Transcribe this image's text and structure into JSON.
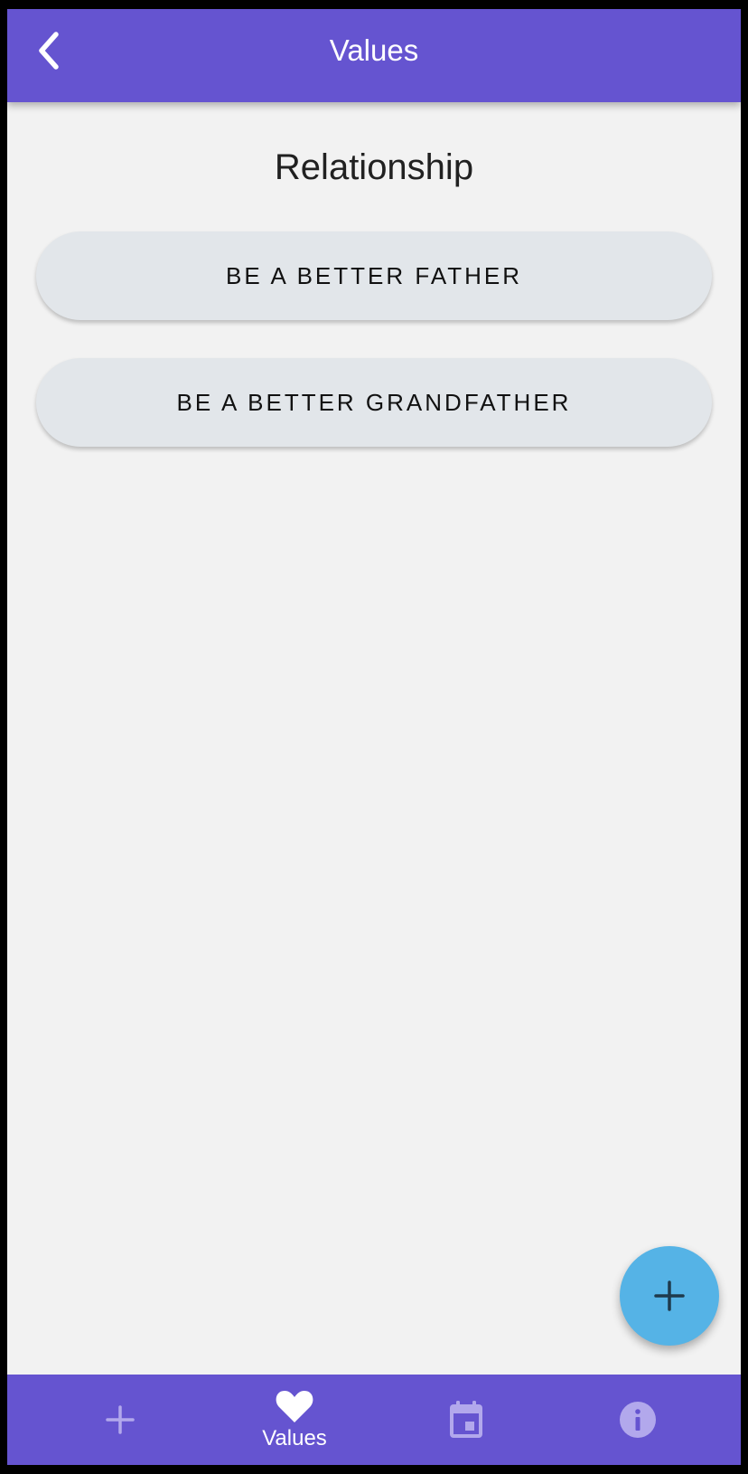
{
  "app_bar": {
    "title": "Values",
    "back_icon": "chevron-left-icon"
  },
  "section": {
    "title": "Relationship"
  },
  "values": [
    {
      "label": "BE A BETTER FATHER"
    },
    {
      "label": "BE A BETTER GRANDFATHER"
    }
  ],
  "fab": {
    "icon": "plus-icon"
  },
  "bottom_nav": {
    "items": [
      {
        "icon": "plus-icon",
        "label": "",
        "active": false
      },
      {
        "icon": "heart-icon",
        "label": "Values",
        "active": true
      },
      {
        "icon": "calendar-icon",
        "label": "",
        "active": false
      },
      {
        "icon": "info-icon",
        "label": "",
        "active": false
      }
    ]
  },
  "colors": {
    "primary": "#6554d0",
    "background": "#f2f2f2",
    "button_bg": "#e2e6ea",
    "fab": "#55b3e6",
    "nav_inactive": "#b2a8ec",
    "nav_active": "#ffffff"
  }
}
